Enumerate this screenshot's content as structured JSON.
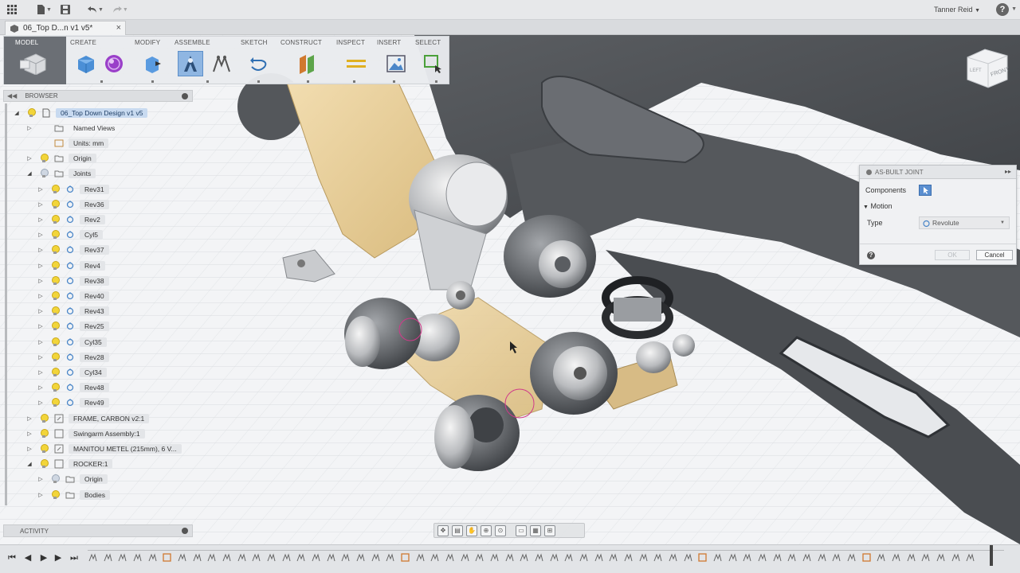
{
  "app": {
    "user_name": "Tanner Reid",
    "help_glyph": "?"
  },
  "document_tab": {
    "title": "06_Top D...n v1 v5*",
    "close_glyph": "×"
  },
  "ribbon": {
    "tabs": [
      "MODEL",
      "CREATE",
      "MODIFY",
      "ASSEMBLE",
      "SKETCH",
      "CONSTRUCT",
      "INSPECT",
      "INSERT",
      "SELECT"
    ],
    "active_tab": "MODEL"
  },
  "browser": {
    "title": "BROWSER",
    "nodes": [
      {
        "label": "06_Top Down Design v1 v5",
        "exp": "◢",
        "bulb": true,
        "icon": "document-icon",
        "selected": true
      },
      {
        "label": "Named Views",
        "exp": "▷",
        "bulb": false,
        "icon": "folder-icon"
      },
      {
        "label": "Units: mm",
        "exp": "",
        "bulb": false,
        "icon": "units-icon"
      },
      {
        "label": "Origin",
        "exp": "▷",
        "bulb": true,
        "icon": "folder-icon"
      },
      {
        "label": "Joints",
        "exp": "◢",
        "bulb": true,
        "bulb_off": true,
        "icon": "folder-icon"
      },
      {
        "label": "Rev31",
        "exp": "▷",
        "bulb": true,
        "icon": "joint-icon"
      },
      {
        "label": "Rev36",
        "exp": "▷",
        "bulb": true,
        "icon": "joint-icon"
      },
      {
        "label": "Rev2",
        "exp": "▷",
        "bulb": true,
        "icon": "joint-icon"
      },
      {
        "label": "Cyl5",
        "exp": "▷",
        "bulb": true,
        "icon": "joint-icon"
      },
      {
        "label": "Rev37",
        "exp": "▷",
        "bulb": true,
        "icon": "joint-icon"
      },
      {
        "label": "Rev4",
        "exp": "▷",
        "bulb": true,
        "icon": "joint-icon"
      },
      {
        "label": "Rev38",
        "exp": "▷",
        "bulb": true,
        "icon": "joint-icon"
      },
      {
        "label": "Rev40",
        "exp": "▷",
        "bulb": true,
        "icon": "joint-icon"
      },
      {
        "label": "Rev43",
        "exp": "▷",
        "bulb": true,
        "icon": "joint-icon"
      },
      {
        "label": "Rev25",
        "exp": "▷",
        "bulb": true,
        "icon": "joint-icon"
      },
      {
        "label": "Cyl35",
        "exp": "▷",
        "bulb": true,
        "icon": "joint-icon"
      },
      {
        "label": "Rev28",
        "exp": "▷",
        "bulb": true,
        "icon": "joint-icon"
      },
      {
        "label": "Cyl34",
        "exp": "▷",
        "bulb": true,
        "icon": "joint-icon"
      },
      {
        "label": "Rev48",
        "exp": "▷",
        "bulb": true,
        "icon": "joint-icon"
      },
      {
        "label": "Rev49",
        "exp": "▷",
        "bulb": true,
        "icon": "joint-icon"
      },
      {
        "label": "FRAME, CARBON v2:1",
        "exp": "▷",
        "bulb": true,
        "icon": "component-link-icon"
      },
      {
        "label": "Swingarm Assembly:1",
        "exp": "▷",
        "bulb": true,
        "icon": "component-icon"
      },
      {
        "label": "MANITOU METEL (215mm), 6 V...",
        "exp": "▷",
        "bulb": true,
        "icon": "component-link-icon"
      },
      {
        "label": "ROCKER:1",
        "exp": "◢",
        "bulb": true,
        "icon": "component-icon"
      },
      {
        "label": "Origin",
        "exp": "▷",
        "bulb": true,
        "bulb_off": true,
        "icon": "folder-icon"
      },
      {
        "label": "Bodies",
        "exp": "▷",
        "bulb": true,
        "icon": "folder-icon"
      }
    ]
  },
  "activity": {
    "title": "ACTIVITY"
  },
  "dialog": {
    "title": "AS-BUILT JOINT",
    "components_label": "Components",
    "motion_label": "Motion",
    "motion_caret": "▼",
    "type_label": "Type",
    "type_value": "Revolute",
    "ok_label": "OK",
    "cancel_label": "Cancel",
    "help_glyph": "?"
  },
  "viewcube": {
    "front_label": "FRONT",
    "left_label": "LEFT"
  },
  "timeline": {
    "item_count": 60
  }
}
